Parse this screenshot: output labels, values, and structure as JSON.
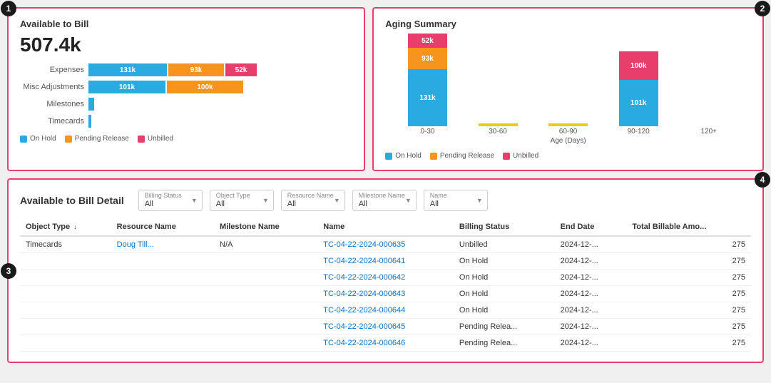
{
  "badges": {
    "b1": "1",
    "b2": "2",
    "b3": "3",
    "b4": "4"
  },
  "available": {
    "title": "Available to Bill",
    "total": "507.4k",
    "bars": [
      {
        "label": "Expenses",
        "blue": 131,
        "orange": 93,
        "red": 52,
        "blueLabel": "131k",
        "orangeLabel": "93k",
        "redLabel": "52k"
      },
      {
        "label": "Misc Adjustments",
        "blue": 101,
        "orange": 100,
        "red": 0,
        "blueLabel": "101k",
        "orangeLabel": "100k",
        "redLabel": ""
      },
      {
        "label": "Milestones",
        "blue": 5,
        "orange": 0,
        "red": 0,
        "blueLabel": "",
        "orangeLabel": "",
        "redLabel": ""
      },
      {
        "label": "Timecards",
        "blue": 2,
        "orange": 0,
        "red": 0,
        "blueLabel": "",
        "orangeLabel": "",
        "redLabel": ""
      }
    ],
    "legend": [
      {
        "color": "#29abe2",
        "label": "On Hold"
      },
      {
        "color": "#f7941d",
        "label": "Pending Release"
      },
      {
        "color": "#e83e6c",
        "label": "Unbilled"
      }
    ]
  },
  "aging": {
    "title": "Aging Summary",
    "cols": [
      {
        "label": "0-30",
        "blueH": 80,
        "orangeH": 0,
        "redH": 0,
        "blueVal": "131k",
        "orangeVal": "",
        "redVal": "",
        "yellowH": 0
      },
      {
        "label": "30-60",
        "blueH": 0,
        "orangeH": 0,
        "redH": 0,
        "blueVal": "",
        "orangeVal": "",
        "redVal": "",
        "yellowH": 4
      },
      {
        "label": "60-90",
        "blueH": 0,
        "orangeH": 0,
        "redH": 0,
        "blueVal": "",
        "orangeVal": "",
        "redVal": "",
        "yellowH": 4
      },
      {
        "label": "90-120",
        "blueH": 60,
        "orangeH": 0,
        "redH": 30,
        "blueVal": "101k",
        "orangeVal": "",
        "redVal": "100k",
        "yellowH": 0
      },
      {
        "label": "120+",
        "blueH": 0,
        "orangeH": 0,
        "redH": 0,
        "blueVal": "",
        "orangeVal": "",
        "redVal": "",
        "yellowH": 0
      }
    ],
    "stackedLabels": {
      "col0": {
        "blue": "131k",
        "orange": "93k",
        "red": "52k"
      },
      "col3": {
        "blue": "101k",
        "red": "100k"
      }
    },
    "axisLabel": "Age (Days)",
    "legend": [
      {
        "color": "#29abe2",
        "label": "On Hold"
      },
      {
        "color": "#f7941d",
        "label": "Pending Release"
      },
      {
        "color": "#e83e6c",
        "label": "Unbilled"
      }
    ]
  },
  "detail": {
    "title": "Available to Bill Detail",
    "filters": [
      {
        "id": "billing-status",
        "label": "Billing Status",
        "value": "All"
      },
      {
        "id": "object-type",
        "label": "Object Type",
        "value": "All"
      },
      {
        "id": "resource-name",
        "label": "Resource Name",
        "value": "All"
      },
      {
        "id": "milestone-name",
        "label": "Milestone Name",
        "value": "All"
      },
      {
        "id": "name",
        "label": "Name",
        "value": "All"
      }
    ],
    "columns": [
      "Object Type",
      "Resource Name",
      "Milestone Name",
      "Name",
      "Billing Status",
      "End Date",
      "Total Billable Amo..."
    ],
    "rows": [
      {
        "objectType": "Timecards",
        "resourceName": "Doug Till...",
        "milestoneName": "N/A",
        "name": "TC-04-22-2024-000635",
        "billingStatus": "Unbilled",
        "endDate": "2024-12-...",
        "totalBillable": "275"
      },
      {
        "objectType": "",
        "resourceName": "",
        "milestoneName": "",
        "name": "TC-04-22-2024-000641",
        "billingStatus": "On Hold",
        "endDate": "2024-12-...",
        "totalBillable": "275"
      },
      {
        "objectType": "",
        "resourceName": "",
        "milestoneName": "",
        "name": "TC-04-22-2024-000642",
        "billingStatus": "On Hold",
        "endDate": "2024-12-...",
        "totalBillable": "275"
      },
      {
        "objectType": "",
        "resourceName": "",
        "milestoneName": "",
        "name": "TC-04-22-2024-000643",
        "billingStatus": "On Hold",
        "endDate": "2024-12-...",
        "totalBillable": "275"
      },
      {
        "objectType": "",
        "resourceName": "",
        "milestoneName": "",
        "name": "TC-04-22-2024-000644",
        "billingStatus": "On Hold",
        "endDate": "2024-12-...",
        "totalBillable": "275"
      },
      {
        "objectType": "",
        "resourceName": "",
        "milestoneName": "",
        "name": "TC-04-22-2024-000645",
        "billingStatus": "Pending Relea...",
        "endDate": "2024-12-...",
        "totalBillable": "275"
      },
      {
        "objectType": "",
        "resourceName": "",
        "milestoneName": "",
        "name": "TC-04-22-2024-000646",
        "billingStatus": "Pending Relea...",
        "endDate": "2024-12-...",
        "totalBillable": "275"
      }
    ]
  }
}
